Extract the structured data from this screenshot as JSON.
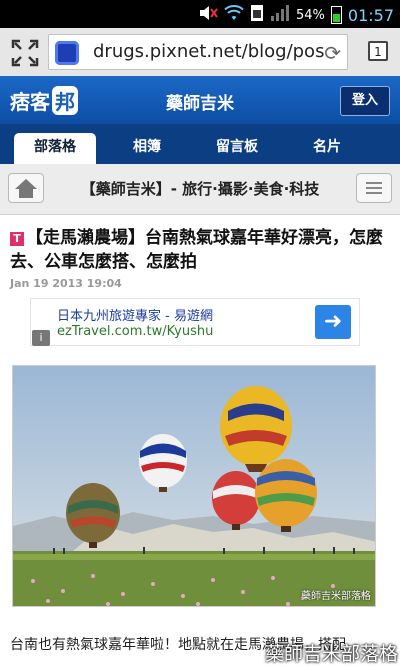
{
  "status_bar": {
    "battery_percent": "54%",
    "time": "01:57",
    "battery_level": 0.54,
    "icons": [
      "mute-icon",
      "wifi-icon",
      "sim-icon",
      "signal-icon",
      "battery-icon"
    ]
  },
  "browser": {
    "url": "drugs.pixnet.net/blog/pos",
    "tab_count": "1"
  },
  "site": {
    "logo_text": "痞客",
    "logo_badge": "邦",
    "title": "藥師吉米",
    "login_label": "登入"
  },
  "nav": {
    "tabs": [
      {
        "label": "部落格",
        "active": true
      },
      {
        "label": "相簿",
        "active": false
      },
      {
        "label": "留言板",
        "active": false
      },
      {
        "label": "名片",
        "active": false
      }
    ]
  },
  "blog": {
    "name": "【藥師吉米】- 旅行·攝影·美食·科技"
  },
  "post": {
    "title": "【走馬瀨農場】台南熱氣球嘉年華好漂亮，怎麼去、公車怎麼搭、怎麼拍",
    "date": "Jan 19 2013 19:04",
    "image_watermark": "藥師吉米部落格",
    "body_start": "台南也有熱氣球嘉年華啦！地點就在走馬瀨農場，搭配"
  },
  "ad": {
    "title": "日本九州旅遊專家 - 易遊網",
    "url": "ezTravel.com.tw/Kyushu",
    "info_label": "i"
  },
  "overlay": {
    "watermark": "藥師吉米部落格"
  },
  "colors": {
    "header_blue": "#1b68c6",
    "nav_navy": "#0c3e84",
    "ad_arrow": "#2b84e6"
  }
}
